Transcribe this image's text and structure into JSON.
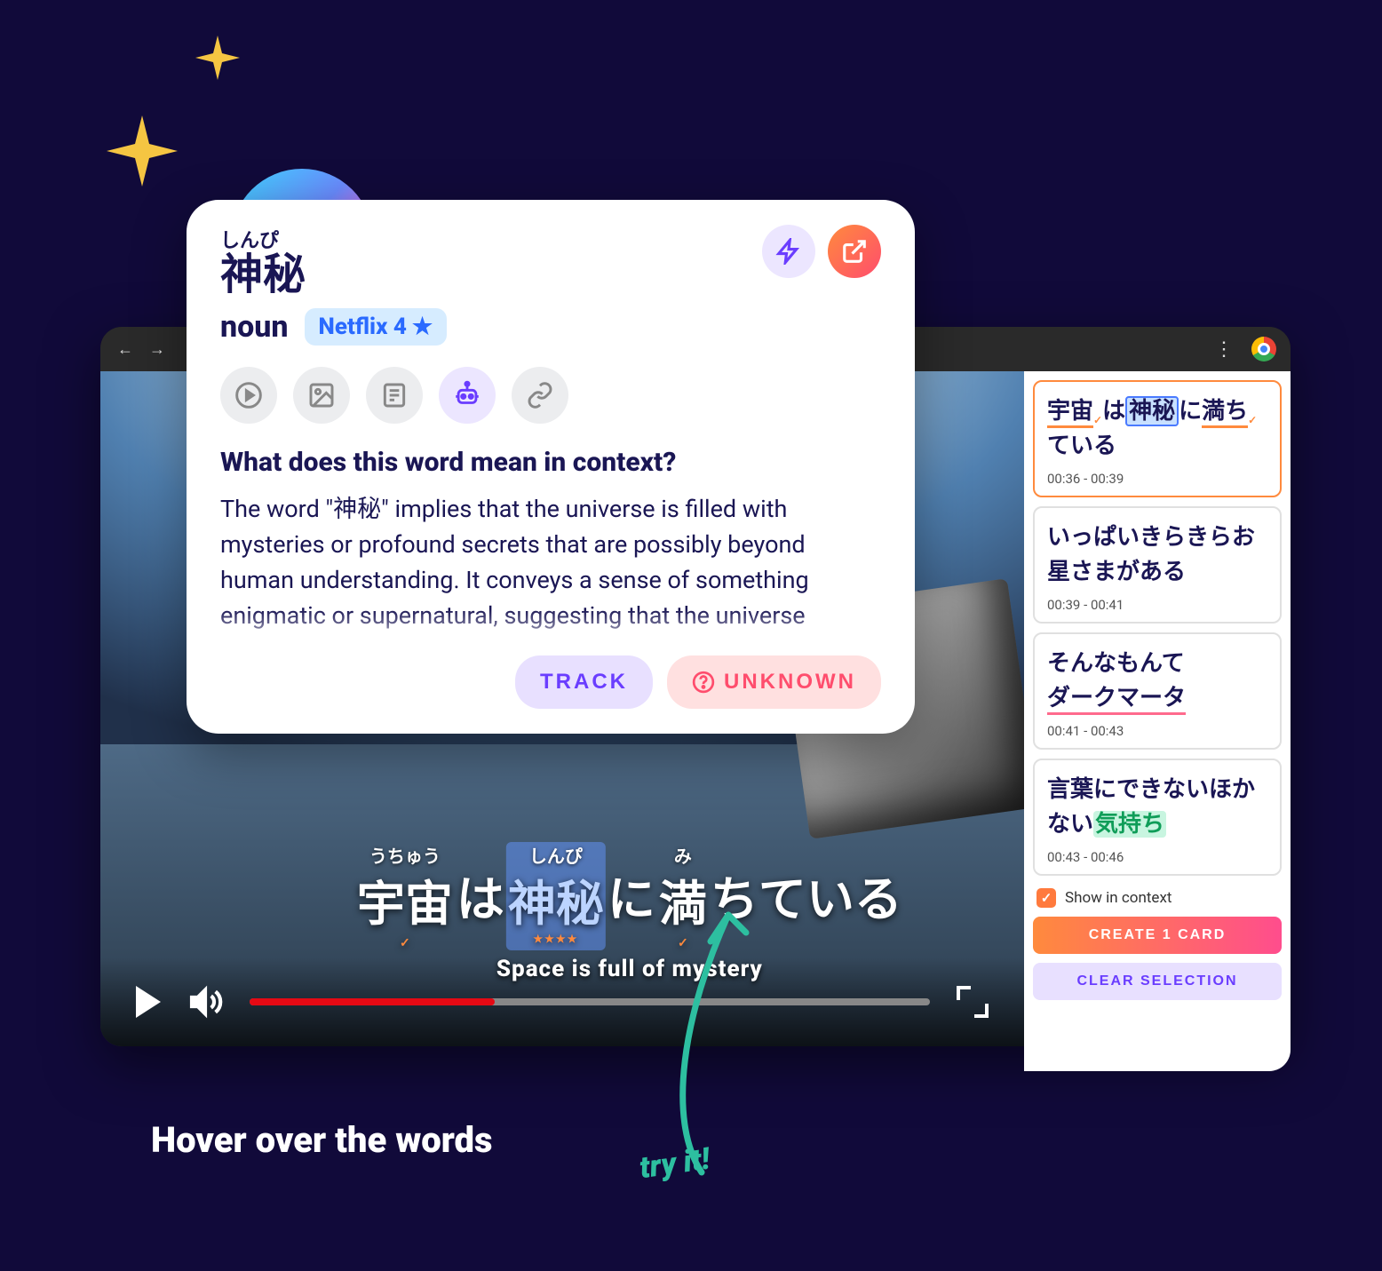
{
  "popup": {
    "furigana": "しんぴ",
    "kanji": "神秘",
    "pos": "noun",
    "badge": "Netflix 4",
    "question": "What does this word mean in context?",
    "answer": "The word \"神秘\" implies that the universe is filled with mysteries or profound secrets that are possibly beyond human understanding. It conveys a sense of something enigmatic or supernatural, suggesting that the universe",
    "track": "TRACK",
    "unknown": "UNKNOWN"
  },
  "subtitle": {
    "words": [
      {
        "ruby": "うちゅう",
        "base": "宇宙",
        "mark": "check"
      },
      {
        "ruby": "",
        "base": "は",
        "mark": ""
      },
      {
        "ruby": "しんぴ",
        "base": "神秘",
        "mark": "stars",
        "highlight": true
      },
      {
        "ruby": "",
        "base": "に",
        "mark": ""
      },
      {
        "ruby": "み",
        "base": "満",
        "mark": "check"
      },
      {
        "ruby": "",
        "base": "ちている",
        "mark": ""
      }
    ],
    "translation": "Space is full of mystery"
  },
  "sidebar": {
    "items": [
      {
        "text_pre": "宇宙",
        "check1": true,
        "text_mid": "は",
        "hl": "神秘",
        "text_post1": "に",
        "ul": "満ち",
        "check2": true,
        "text_post2": "ている",
        "time": "00:36 - 00:39",
        "active": true
      },
      {
        "line": "いっぱいきらきらお星さまがある",
        "time": "00:39 - 00:41"
      },
      {
        "line1": "そんなもんて",
        "line2_ul": "ダークマータ",
        "time": "00:41 - 00:43"
      },
      {
        "line_pre": "言葉にできないほかない",
        "hl_green": "気持ち",
        "time": "00:43 - 00:46"
      }
    ],
    "show_in_context": "Show in context",
    "create": "CREATE 1 CARD",
    "clear": "CLEAR SELECTION"
  },
  "caption": {
    "hover": "Hover over the words",
    "try": "try it!"
  }
}
